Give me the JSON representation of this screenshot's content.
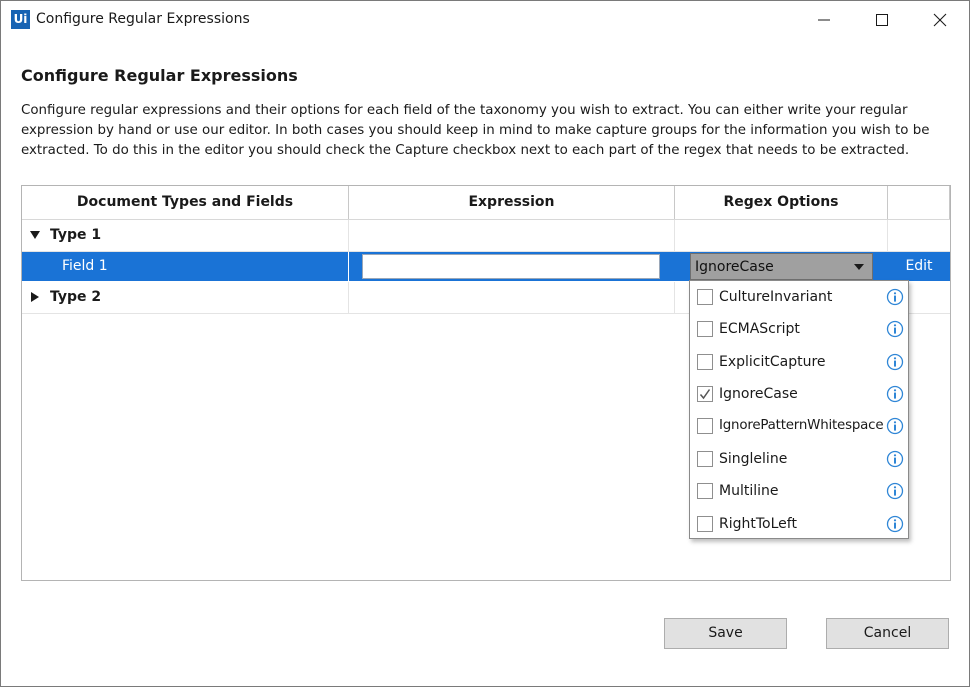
{
  "window": {
    "logo_text": "Ui",
    "title": "Configure Regular Expressions"
  },
  "heading": "Configure Regular Expressions",
  "description": "Configure regular expressions and their options for each field of the taxonomy you wish to extract. You can either write your regular expression by hand or use our editor. In both cases you should keep in mind to make capture groups for the information you wish to be extracted. To do this in the editor you should check the Capture checkbox next to each part of the regex that needs to be extracted.",
  "grid": {
    "columns": [
      "Document Types and Fields",
      "Expression",
      "Regex Options",
      ""
    ],
    "rows": {
      "type1": {
        "label": "Type 1",
        "expanded": true
      },
      "field1": {
        "label": "Field 1",
        "expression": "",
        "regex_selected": "IgnoreCase",
        "edit_label": "Edit",
        "selected": true
      },
      "type2": {
        "label": "Type 2",
        "expanded": false
      }
    }
  },
  "regex_options": [
    {
      "label": "CultureInvariant",
      "checked": false
    },
    {
      "label": "ECMAScript",
      "checked": false
    },
    {
      "label": "ExplicitCapture",
      "checked": false
    },
    {
      "label": "IgnoreCase",
      "checked": true
    },
    {
      "label": "IgnorePatternWhitespace",
      "checked": false
    },
    {
      "label": "Singleline",
      "checked": false
    },
    {
      "label": "Multiline",
      "checked": false
    },
    {
      "label": "RightToLeft",
      "checked": false
    }
  ],
  "footer": {
    "save_label": "Save",
    "cancel_label": "Cancel"
  },
  "colors": {
    "selection": "#1a73d6",
    "logo": "#1763b3",
    "info": "#2f86d6"
  }
}
